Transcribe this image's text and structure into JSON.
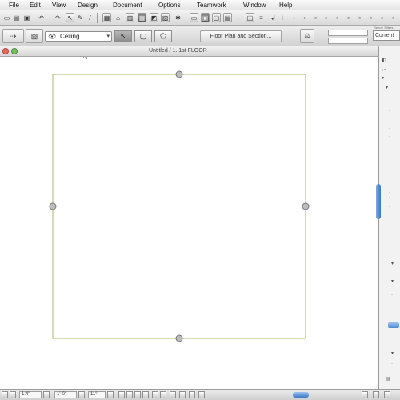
{
  "menu": {
    "items": [
      "File",
      "Edit",
      "View",
      "Design",
      "Document",
      "Options",
      "Teamwork",
      "Window",
      "Help"
    ]
  },
  "toolbar2": {
    "layer_value": "Ceiling",
    "view_label": "Floor Plan and Section...",
    "current_tab": "Current",
    "mode_label": "Renov. Filters"
  },
  "window": {
    "title": "Untitled / 1. 1st FLOOR"
  },
  "statusbar": {
    "field1": "1:4\"",
    "field2": "1'-0\"",
    "field3": "11°"
  },
  "colors": {
    "wall_line": "#b9c08a",
    "handle": "#8a8a8a",
    "accent_blue": "#3c77c4"
  },
  "icons": [
    "undo-icon",
    "redo-icon",
    "arrow-icon",
    "pencil-icon",
    "zoom-icon",
    "eye-icon",
    "magic-wand-icon",
    "select-rect-icon",
    "close-window-icon"
  ]
}
